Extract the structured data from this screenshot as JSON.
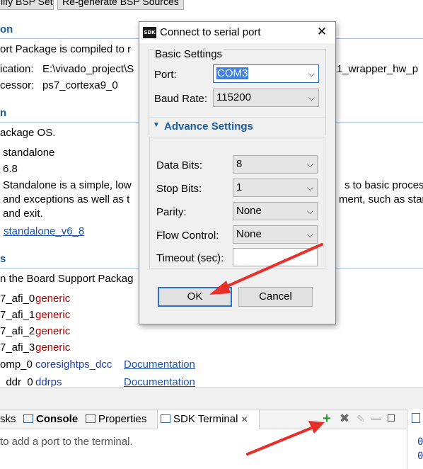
{
  "toolbar": {
    "modify_bsp_label": "lify BSP Settings",
    "regen_bsp_label": "Re-generate BSP Sources"
  },
  "overview": {
    "sec1_title": "on",
    "sec1_line1": "ort Package is compiled to r",
    "sec1_app_label": "ication:",
    "sec1_app_value": "E:\\vivado_project\\S",
    "sec1_app_value_tail": "1_wrapper_hw_p",
    "sec1_proc_label": "cessor:",
    "sec1_proc_value": "ps7_cortexa9_0",
    "sec2_title": "n",
    "sec2_line1": "ackage OS.",
    "os_name": "standalone",
    "os_version": "6.8",
    "os_desc1": "Standalone is a simple, low",
    "os_desc1_tail": "s to basic proces",
    "os_desc2": "and exceptions as well as t",
    "os_desc2_tail": "ment, such as stanc",
    "os_desc3": "and exit.",
    "os_doc_link": "standalone_v6_8",
    "sec3_title": "s",
    "sec3_line1": "n the Board Support Packag",
    "drivers": [
      {
        "name": "7_afi_0",
        "driver": "generic",
        "doc": ""
      },
      {
        "name": "7_afi_1",
        "driver": "generic",
        "doc": ""
      },
      {
        "name": "7_afi_2",
        "driver": "generic",
        "doc": ""
      },
      {
        "name": "7_afi_3",
        "driver": "generic",
        "doc": ""
      },
      {
        "name": "omp_0",
        "driver": "coresightps_dcc",
        "doc": "Documentation"
      },
      {
        "name": "_ddr_0",
        "driver": "ddrps",
        "doc": "Documentation"
      }
    ]
  },
  "views": {
    "tab_tasks": "sks",
    "tab_console": "Console",
    "tab_properties": "Properties",
    "tab_sdk_terminal": "SDK Terminal",
    "terminal_hint": "to add a port to the terminal.",
    "right_digits": [
      "0",
      "0"
    ]
  },
  "dialog": {
    "logo_text": "SDK",
    "title": "Connect to serial port",
    "basic_legend": "Basic Settings",
    "port_label": "Port:",
    "port_value": "COM3",
    "baud_label": "Baud Rate:",
    "baud_value": "115200",
    "advance_label": "Advance Settings",
    "data_bits_label": "Data Bits:",
    "data_bits_value": "8",
    "stop_bits_label": "Stop Bits:",
    "stop_bits_value": "1",
    "parity_label": "Parity:",
    "parity_value": "None",
    "flow_label": "Flow Control:",
    "flow_value": "None",
    "timeout_label": "Timeout (sec):",
    "timeout_value": "",
    "ok_label": "OK",
    "cancel_label": "Cancel"
  },
  "colors": {
    "accent": "#2b6ed1",
    "section_header": "#1a5c9c",
    "driver_generic": "#b00000",
    "annotation_arrow": "#e8302a"
  }
}
